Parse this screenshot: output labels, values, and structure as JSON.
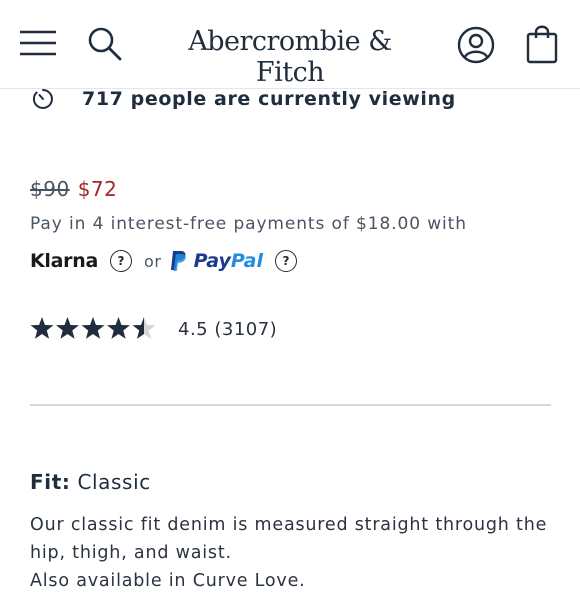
{
  "header": {
    "brand": "Abercrombie & Fitch",
    "menu_icon": "hamburger-menu-icon",
    "search_icon": "search-icon",
    "account_icon": "user-account-icon",
    "bag_icon": "shopping-bag-icon"
  },
  "viewing": {
    "text": "717 people are currently viewing",
    "icon": "timer-icon"
  },
  "price": {
    "original": "$90",
    "sale": "$72",
    "sale_color": "#a3262d"
  },
  "payment": {
    "installment_text": "Pay in 4 interest-free payments of $18.00 with",
    "klarna_label": "Klarna",
    "or_text": "or",
    "paypal_label_1": "Pay",
    "paypal_label_2": "Pal",
    "help_glyph": "?"
  },
  "rating": {
    "value": 4.5,
    "max": 5,
    "text": "4.5 (3107)"
  },
  "fit": {
    "label": "Fit:",
    "value": "Classic"
  },
  "description": {
    "lines": [
      "Our classic fit denim is measured straight through the",
      "hip, thigh, and waist.",
      "Also available in Curve Love."
    ]
  }
}
